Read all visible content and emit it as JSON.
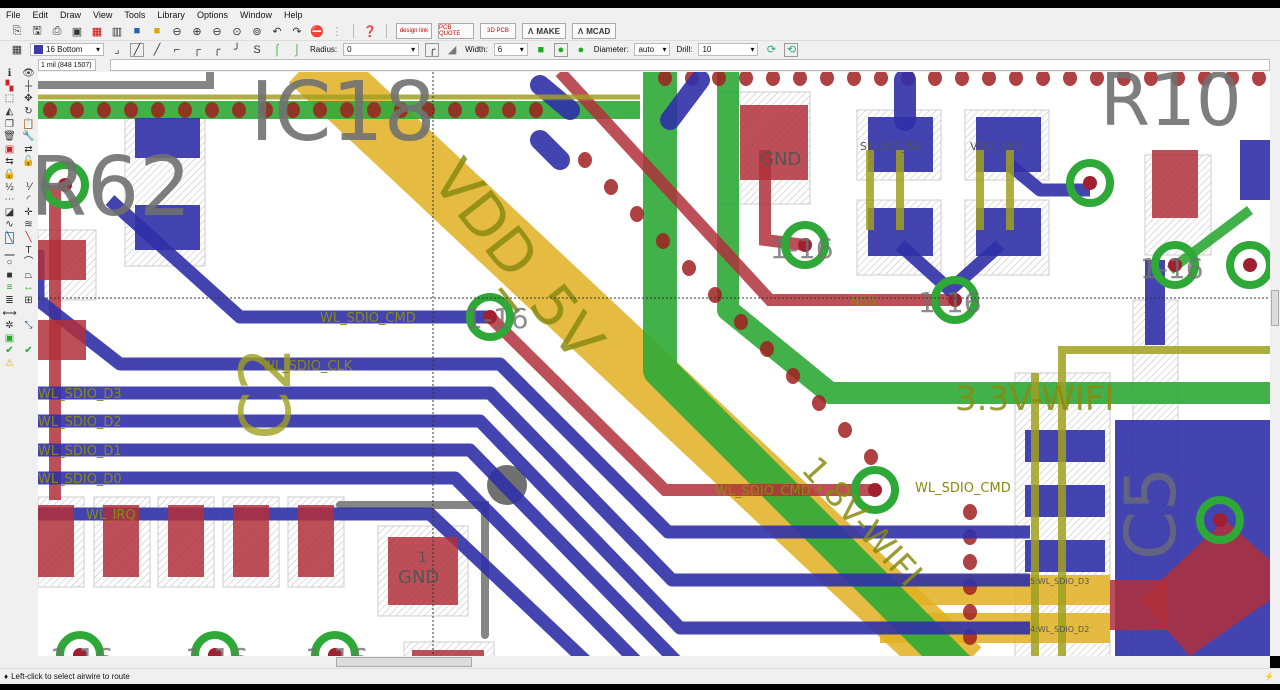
{
  "menu": [
    "File",
    "Edit",
    "Draw",
    "View",
    "Tools",
    "Library",
    "Options",
    "Window",
    "Help"
  ],
  "toolbar1": {
    "make_label": "MAKE",
    "mcad_label": "MCAD",
    "logo1": "design link",
    "logo2": "PCB QUOTE",
    "logo3": "3D PCB"
  },
  "toolbar2": {
    "layer": "16 Bottom",
    "layer_color": "#3b3ba8",
    "radius_label": "Radius:",
    "radius": "0",
    "width_label": "Width:",
    "width": "6",
    "diameter_label": "Diameter:",
    "diameter": "auto",
    "drill_label": "Drill:",
    "drill": "10"
  },
  "command": {
    "coord": "1 mil (848 1507)",
    "input": ""
  },
  "status": {
    "message": "Left-click to select airwire to route"
  },
  "colors": {
    "top": "#b0303a",
    "bottom": "#3030a8",
    "green": "#2ea836",
    "yellow": "#e0b020",
    "olive": "#a0a020",
    "gray": "#707070"
  },
  "board": {
    "ic18": "IC18",
    "r62": "R62",
    "r10": "R10",
    "vdd5": "VDD_5V",
    "v33": "3.3V-WIFI",
    "v18": "1.8V-WIFI",
    "cmd": "WL_SDIO_CMD",
    "clk": "WL_SDIO_CLK",
    "d3": "WL_SDIO_D3",
    "d2": "WL_SDIO_D2",
    "d1": "WL_SDIO_D1",
    "d0": "WL_SDIO_D0",
    "irq": "WL_IRQ",
    "nss": "NSS",
    "gnd": "GND",
    "via": "1-16",
    "pad1": "1",
    "sel5": "SELECT_5V",
    "vdd33": "VDD_3V3",
    "p5": "5:WL_SDIO_D3",
    "p4": "4:WL_SDIO_D2",
    "c5": "C5",
    "c2": "C2"
  }
}
